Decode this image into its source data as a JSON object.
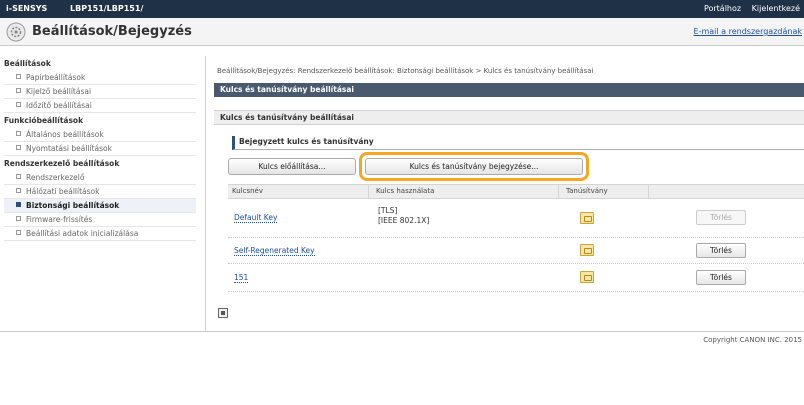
{
  "topbar": {
    "brand": "i-SENSYS",
    "model": "LBP151/LBP151/",
    "links": [
      "Portálhoz",
      "Kijelentkezé"
    ]
  },
  "header": {
    "title": "Beállítások/Bejegyzés",
    "email_link": "E-mail a rendszergazdának"
  },
  "sidebar": {
    "groups": [
      {
        "label": "Beállítások",
        "items": [
          "Papírbeállítások",
          "Kijelző beállításai",
          "Időzítő beállításai"
        ]
      },
      {
        "label": "Funkcióbeállítások",
        "items": [
          "Általános beállítások",
          "Nyomtatási beállítások"
        ]
      },
      {
        "label": "Rendszerkezelő beállítások",
        "items": [
          "Rendszerkezelő",
          "Hálózati beállítások",
          "Biztonsági beállítások",
          "Firmware-frissítés",
          "Beállítási adatok inicializálása"
        ]
      }
    ],
    "active_item": "Biztonsági beállítások"
  },
  "main": {
    "breadcrumb": "Beállítások/Bejegyzés: Rendszerkezelő beállítások: Biztonsági beállítások > Kulcs és tanúsítvány beállításai",
    "section_title": "Kulcs és tanúsítvány beállításai",
    "subtitle": "Kulcs és tanúsítvány beállításai",
    "registered_title": "Bejegyzett kulcs és tanúsítvány",
    "buttons": {
      "generate": "Kulcs előállítása...",
      "register": "Kulcs és tanúsítvány bejegyzése..."
    },
    "table": {
      "headers": [
        "Kulcsnév",
        "Kulcs használata",
        "Tanúsítvány",
        ""
      ],
      "rows": [
        {
          "alias": "Default Key",
          "usage_line1": "[TLS]",
          "usage_line2": "[IEEE 802.1X]",
          "delete": "Törlés",
          "delete_enabled": false
        },
        {
          "alias": "Self-Regenerated Key",
          "usage_line1": "",
          "usage_line2": "",
          "delete": "Törlés",
          "delete_enabled": true
        },
        {
          "alias": "151",
          "usage_line1": "",
          "usage_line2": "",
          "delete": "Törlés",
          "delete_enabled": true
        }
      ]
    }
  },
  "footer": {
    "copyright": "Copyright CANON INC. 2015"
  }
}
